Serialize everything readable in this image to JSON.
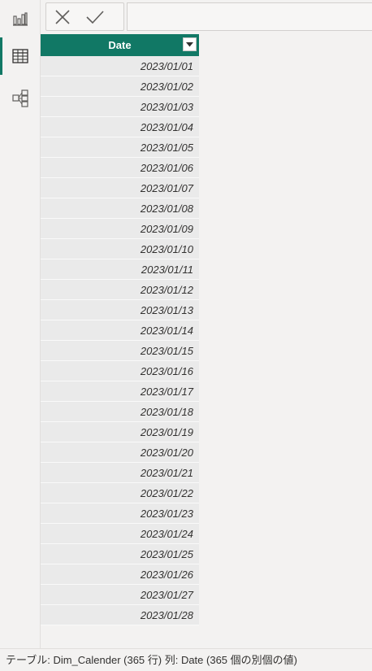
{
  "colors": {
    "accent": "#117865",
    "header_text": "#ffffff",
    "row_bg": "#eaeaea"
  },
  "rail": {
    "items": [
      {
        "icon": "report-view-icon",
        "active": false
      },
      {
        "icon": "table-view-icon",
        "active": true
      },
      {
        "icon": "model-view-icon",
        "active": false
      }
    ]
  },
  "formula_bar": {
    "cancel_icon": "x-icon",
    "commit_icon": "checkmark-icon",
    "value": ""
  },
  "table": {
    "column": "Date",
    "rows": [
      "2023/01/01",
      "2023/01/02",
      "2023/01/03",
      "2023/01/04",
      "2023/01/05",
      "2023/01/06",
      "2023/01/07",
      "2023/01/08",
      "2023/01/09",
      "2023/01/10",
      "2023/01/11",
      "2023/01/12",
      "2023/01/13",
      "2023/01/14",
      "2023/01/15",
      "2023/01/16",
      "2023/01/17",
      "2023/01/18",
      "2023/01/19",
      "2023/01/20",
      "2023/01/21",
      "2023/01/22",
      "2023/01/23",
      "2023/01/24",
      "2023/01/25",
      "2023/01/26",
      "2023/01/27",
      "2023/01/28"
    ]
  },
  "status": {
    "text": "テーブル: Dim_Calender (365 行) 列: Date (365 個の別個の値)"
  }
}
